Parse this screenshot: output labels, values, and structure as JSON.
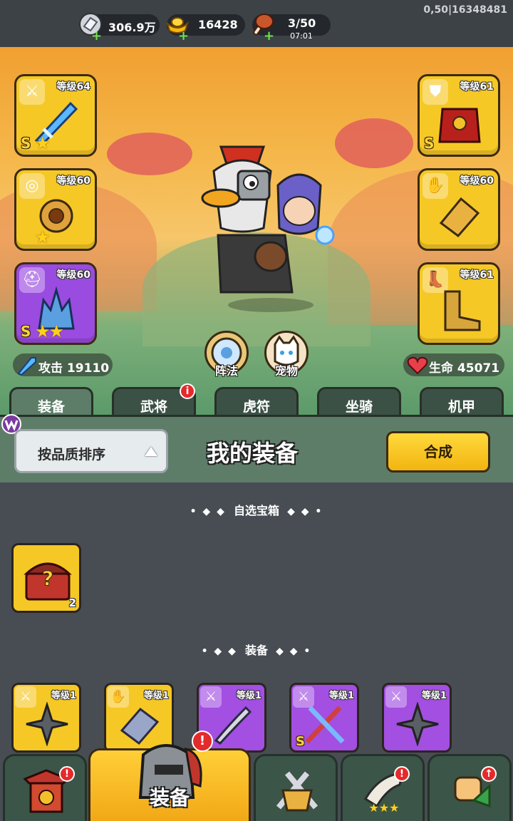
{
  "resources": {
    "silver": {
      "value": "306.9万",
      "icon": "silver-coin-icon"
    },
    "gold": {
      "value": "16428",
      "icon": "gold-ingot-icon"
    },
    "stamina": {
      "value": "3/50",
      "timer": "07:01",
      "icon": "meat-drumstick-icon"
    }
  },
  "debug_coord": "0,50|16348481",
  "equipped": {
    "left": [
      {
        "level": "等级64",
        "grade": "S",
        "stars": "★",
        "type": "sword",
        "rarity": "gold"
      },
      {
        "level": "等级60",
        "grade": "",
        "stars": "★",
        "type": "medal",
        "rarity": "gold"
      },
      {
        "level": "等级60",
        "grade": "S",
        "stars": "★★",
        "type": "helmet",
        "rarity": "purple"
      }
    ],
    "right": [
      {
        "level": "等级61",
        "grade": "S",
        "stars": "",
        "type": "armor",
        "rarity": "gold"
      },
      {
        "level": "等级60",
        "grade": "",
        "stars": "",
        "type": "gauntlet",
        "rarity": "gold"
      },
      {
        "level": "等级61",
        "grade": "",
        "stars": "",
        "type": "boots",
        "rarity": "gold"
      }
    ]
  },
  "stats": {
    "attack": "攻击 19110",
    "hp": "生命 45071"
  },
  "actions": {
    "formation": "阵法",
    "pet": "宠物"
  },
  "tabs": [
    {
      "label": "装备",
      "active": true,
      "badge": ""
    },
    {
      "label": "武将",
      "active": false,
      "badge": "i"
    },
    {
      "label": "虎符",
      "active": false,
      "badge": ""
    },
    {
      "label": "坐骑",
      "active": false,
      "badge": ""
    },
    {
      "label": "机甲",
      "active": false,
      "badge": ""
    }
  ],
  "panel": {
    "sort_label": "按品质排序",
    "title": "我的装备",
    "compose_label": "合成"
  },
  "sections": {
    "chest": {
      "title": "自选宝箱",
      "dots_left": "• ◆ ◆",
      "dots_right": "◆ ◆ •"
    },
    "equipment": {
      "title": "装备",
      "dots_left": "• ◆ ◆",
      "dots_right": "◆ ◆ •"
    }
  },
  "chest_items": [
    {
      "count": "2",
      "icon": "mystery-chest-icon"
    }
  ],
  "inventory": [
    {
      "level": "等级1",
      "rarity": "gold",
      "type": "sword",
      "art": "shuriken",
      "grade": ""
    },
    {
      "level": "等级1",
      "rarity": "gold",
      "type": "gauntlet",
      "art": "bracer",
      "grade": ""
    },
    {
      "level": "等级1",
      "rarity": "purple",
      "type": "sword",
      "art": "dagger",
      "grade": ""
    },
    {
      "level": "等级1",
      "rarity": "purple",
      "type": "sword",
      "art": "crossed-swords",
      "grade": "S"
    },
    {
      "level": "等级1",
      "rarity": "purple",
      "type": "sword",
      "art": "shuriken",
      "grade": ""
    }
  ],
  "bottom_nav": [
    {
      "label": "",
      "icon": "shop-gate-icon",
      "badge": "!"
    },
    {
      "label": "装备",
      "icon": "knight-helmet-icon",
      "badge": "!",
      "active": true
    },
    {
      "label": "",
      "icon": "battle-swords-icon",
      "badge": ""
    },
    {
      "label": "",
      "icon": "horn-icon",
      "badge": "!"
    },
    {
      "label": "",
      "icon": "upgrade-fist-icon",
      "badge": "↑"
    }
  ],
  "colors": {
    "gold_rarity": "#f6c825",
    "purple_rarity": "#9a4be0",
    "panel_green": "#5d7d68",
    "badge_red": "#e42a2a"
  }
}
